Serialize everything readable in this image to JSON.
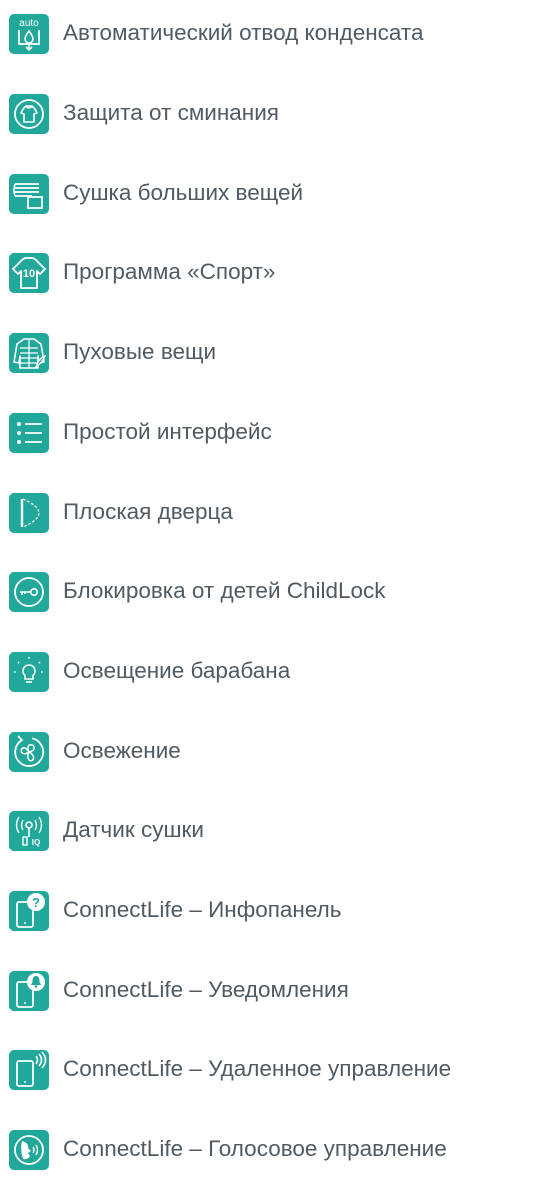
{
  "theme": {
    "accent": "#21a89a",
    "icon_fg": "#ffffff",
    "text": "#4f5a63"
  },
  "features": [
    {
      "icon": "condensate-auto-drain-icon",
      "icon_text": "auto",
      "label": "Автоматический отвод конденсата"
    },
    {
      "icon": "anti-crease-icon",
      "label": "Защита от сминания"
    },
    {
      "icon": "bulky-items-icon",
      "label": "Сушка больших вещей"
    },
    {
      "icon": "sport-jersey-icon",
      "icon_text": "10",
      "label": "Программа «Спорт»"
    },
    {
      "icon": "down-jacket-icon",
      "label": "Пуховые вещи"
    },
    {
      "icon": "menu-list-icon",
      "label": "Простой интерфейс"
    },
    {
      "icon": "flat-door-icon",
      "label": "Плоская дверца"
    },
    {
      "icon": "child-lock-key-icon",
      "label": "Блокировка от детей ChildLock"
    },
    {
      "icon": "drum-light-bulb-icon",
      "label": "Освещение барабана"
    },
    {
      "icon": "refresh-fan-icon",
      "label": "Освежение"
    },
    {
      "icon": "dryness-sensor-icon",
      "icon_text": "IQ",
      "label": "Датчик сушки"
    },
    {
      "icon": "phone-info-icon",
      "icon_text": "?",
      "label": "ConnectLife – Инфопанель"
    },
    {
      "icon": "phone-notification-icon",
      "label": "ConnectLife – Уведомления"
    },
    {
      "icon": "phone-remote-icon",
      "label": "ConnectLife – Удаленное управление"
    },
    {
      "icon": "voice-control-icon",
      "label": "ConnectLife – Голосовое управление"
    }
  ]
}
